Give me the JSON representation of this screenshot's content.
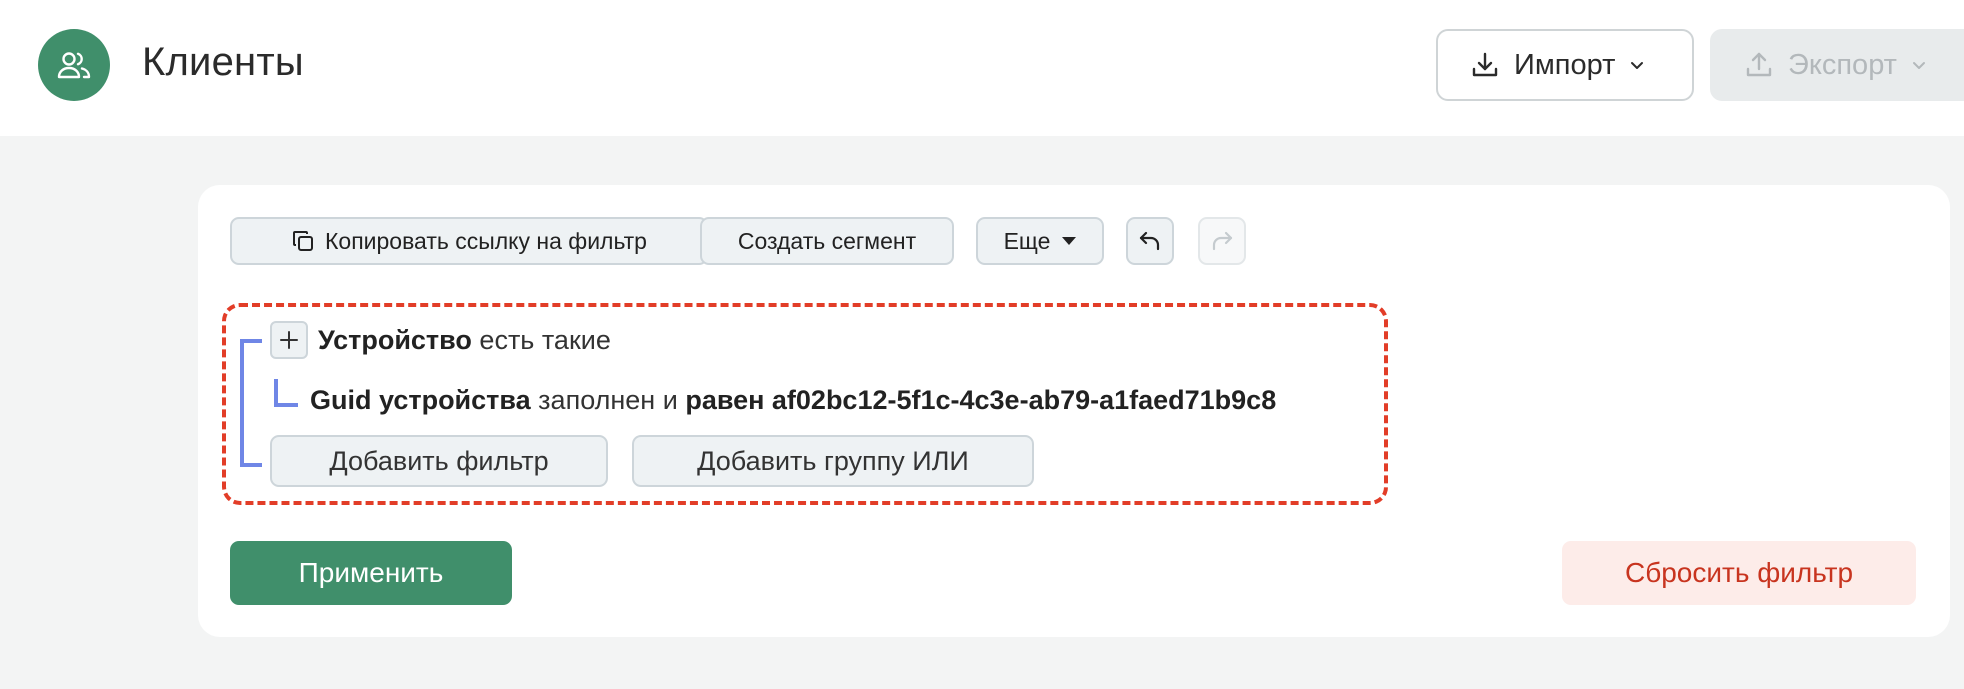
{
  "header": {
    "title": "Клиенты",
    "avatar_icon": "users-icon",
    "import_label": "Импорт",
    "export_label": "Экспорт",
    "accent_color": "#408f6b"
  },
  "toolbar": {
    "copy_link_label": "Копировать ссылку на фильтр",
    "create_segment_label": "Создать сегмент",
    "more_label": "Еще"
  },
  "filter": {
    "group_entity": "Устройство",
    "group_quantifier": "есть такие",
    "condition": {
      "field": "Guid устройства",
      "state": "заполнен",
      "conjunction": "и",
      "operator_value": "равен af02bc12-5f1c-4c3e-ab79-a1faed71b9c8"
    },
    "add_filter_label": "Добавить фильтр",
    "add_or_group_label": "Добавить группу ИЛИ"
  },
  "actions": {
    "apply_label": "Применить",
    "reset_label": "Сбросить фильтр"
  }
}
